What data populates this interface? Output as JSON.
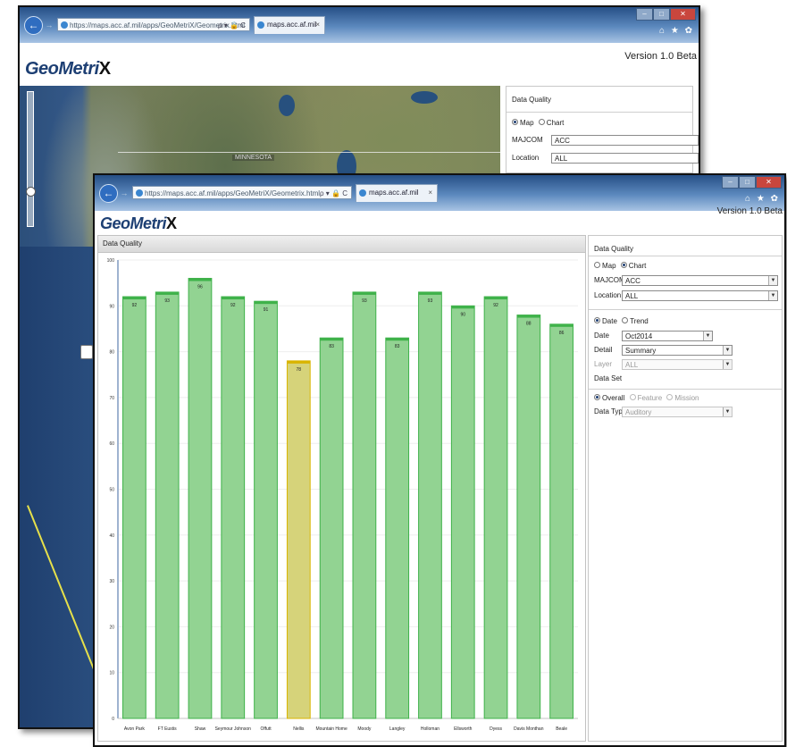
{
  "back_window": {
    "url": "https://maps.acc.af.mil/apps/GeoMetriX/Geometrix.html",
    "address_tools": "ρ ▾ 🔒 C",
    "tab_title": "maps.acc.af.mil",
    "tab_close": "×",
    "logo": "GeoMetri",
    "logo_mark": "X",
    "version": "Version 1.0 Beta",
    "map_label": "MINNESOTA",
    "panel": {
      "title": "Data Quality",
      "radio_map": "Map",
      "radio_chart": "Chart",
      "majcom_label": "MAJCOM",
      "majcom_value": "ACC",
      "location_label": "Location",
      "location_value": "ALL"
    }
  },
  "front_window": {
    "url": "https://maps.acc.af.mil/apps/GeoMetriX/Geometrix.html",
    "address_tools": "ρ ▾ 🔒 C",
    "tab_title": "maps.acc.af.mil",
    "tab_close": "×",
    "logo": "GeoMetri",
    "logo_mark": "X",
    "version": "Version 1.0 Beta",
    "chart_panel_title": "Data Quality",
    "panel": {
      "title": "Data Quality",
      "radio_map": "Map",
      "radio_chart": "Chart",
      "majcom_label": "MAJCOM",
      "majcom_value": "ACC",
      "location_label": "Location",
      "location_value": "ALL",
      "radio_date": "Date",
      "radio_trend": "Trend",
      "date_label": "Date",
      "date_value": "Oct2014",
      "detail_label": "Detail",
      "detail_value": "Summary",
      "layer_label": "Layer",
      "layer_value": "ALL",
      "dataset_label": "Data Set",
      "radio_overall": "Overall",
      "radio_feature": "Feature",
      "radio_mission": "Mission",
      "datatype_label": "Data Type",
      "datatype_value": "Auditory"
    }
  },
  "window_controls": {
    "minimize": "–",
    "maximize": "□",
    "close": "✕"
  },
  "ie_tools": "⌂ ★ ✿",
  "nav": {
    "back": "←",
    "forward": "→"
  },
  "colors": {
    "bar_green": "#92d392",
    "bar_green_border": "#3fb24a",
    "bar_yellow": "#d6d37a",
    "bar_yellow_border": "#d9b400",
    "title_blue": "#1d3f73"
  },
  "chart_data": {
    "type": "bar",
    "title": "Data Quality",
    "categories": [
      "Avon Park",
      "FT Eustis",
      "Shaw",
      "Seymour Johnson",
      "Offutt",
      "Nellis",
      "Mountain Home",
      "Moody",
      "Langley",
      "Holloman",
      "Ellsworth",
      "Dyess",
      "Davis Monthan",
      "Beale"
    ],
    "values": [
      92,
      93,
      96,
      92,
      91,
      78,
      83,
      93,
      83,
      93,
      90,
      92,
      88,
      86
    ],
    "value_labels": [
      "92",
      "93",
      "96",
      "92",
      "91",
      "78",
      "83",
      "93",
      "83",
      "93",
      "90",
      "92",
      "88",
      "86"
    ],
    "highlight_index": 5,
    "ylim": [
      0,
      100
    ],
    "yticks": [
      0,
      10,
      20,
      30,
      40,
      50,
      60,
      70,
      80,
      90,
      100
    ],
    "xlabel": "",
    "ylabel": "",
    "grid": true,
    "legend": "none"
  }
}
